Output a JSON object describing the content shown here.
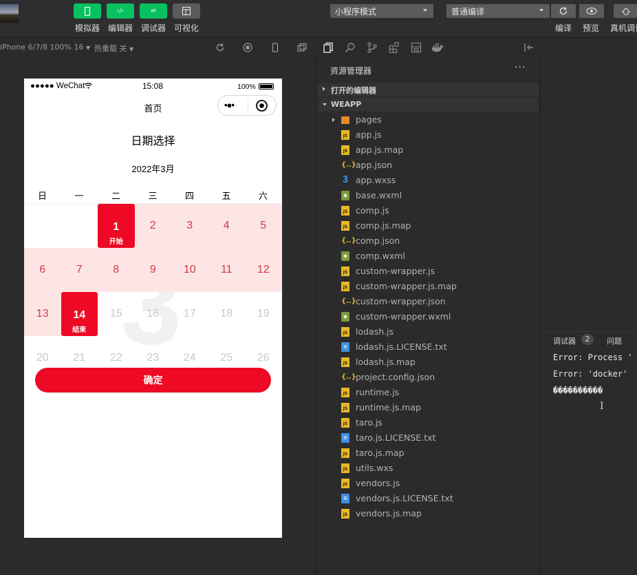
{
  "toolbar": {
    "buttons": [
      {
        "label": "模拟器"
      },
      {
        "label": "编辑器"
      },
      {
        "label": "调试器"
      },
      {
        "label": "可视化"
      }
    ],
    "mode_select": "小程序模式",
    "compile_select": "普通编译",
    "right_labels": [
      "编译",
      "预览",
      "真机调试"
    ]
  },
  "simbar": {
    "device": "iPhone 6/7/8 100% 16",
    "hot_reload": "热重载 关"
  },
  "phone": {
    "status": {
      "carrier": "●●●●● WeChat",
      "time": "15:08",
      "battery": "100%"
    },
    "nav_title": "首页",
    "page_title": "日期选择",
    "month": "2022年3月",
    "watermark": "3",
    "weekdays": [
      "日",
      "一",
      "二",
      "三",
      "四",
      "五",
      "六"
    ],
    "rows": [
      [
        {
          "d": "",
          "s": "empty"
        },
        {
          "d": "",
          "s": "empty"
        },
        {
          "d": "1",
          "s": "start",
          "sub": "开始"
        },
        {
          "d": "2",
          "s": "range"
        },
        {
          "d": "3",
          "s": "range"
        },
        {
          "d": "4",
          "s": "range"
        },
        {
          "d": "5",
          "s": "range"
        }
      ],
      [
        {
          "d": "6",
          "s": "range"
        },
        {
          "d": "7",
          "s": "range"
        },
        {
          "d": "8",
          "s": "range"
        },
        {
          "d": "9",
          "s": "range"
        },
        {
          "d": "10",
          "s": "range"
        },
        {
          "d": "11",
          "s": "range"
        },
        {
          "d": "12",
          "s": "range"
        }
      ],
      [
        {
          "d": "13",
          "s": "range"
        },
        {
          "d": "14",
          "s": "end",
          "sub": "结束"
        },
        {
          "d": "15",
          "s": "muted"
        },
        {
          "d": "16",
          "s": "muted"
        },
        {
          "d": "17",
          "s": "muted"
        },
        {
          "d": "18",
          "s": "muted"
        },
        {
          "d": "19",
          "s": "muted"
        }
      ],
      [
        {
          "d": "20",
          "s": "muted"
        },
        {
          "d": "21",
          "s": "muted"
        },
        {
          "d": "22",
          "s": "muted"
        },
        {
          "d": "23",
          "s": "muted"
        },
        {
          "d": "24",
          "s": "muted"
        },
        {
          "d": "25",
          "s": "muted"
        },
        {
          "d": "26",
          "s": "muted"
        }
      ]
    ],
    "confirm": "确定"
  },
  "explorer": {
    "title": "资源管理器",
    "more": "···",
    "open_editors": "打开的编辑器",
    "root": "WEAPP",
    "files": [
      {
        "name": "pages",
        "type": "folder"
      },
      {
        "name": "app.js",
        "type": "js"
      },
      {
        "name": "app.js.map",
        "type": "js"
      },
      {
        "name": "app.json",
        "type": "json"
      },
      {
        "name": "app.wxss",
        "type": "wxss"
      },
      {
        "name": "base.wxml",
        "type": "wxml"
      },
      {
        "name": "comp.js",
        "type": "js"
      },
      {
        "name": "comp.js.map",
        "type": "js"
      },
      {
        "name": "comp.json",
        "type": "json"
      },
      {
        "name": "comp.wxml",
        "type": "wxml"
      },
      {
        "name": "custom-wrapper.js",
        "type": "js"
      },
      {
        "name": "custom-wrapper.js.map",
        "type": "js"
      },
      {
        "name": "custom-wrapper.json",
        "type": "json"
      },
      {
        "name": "custom-wrapper.wxml",
        "type": "wxml"
      },
      {
        "name": "lodash.js",
        "type": "js"
      },
      {
        "name": "lodash.js.LICENSE.txt",
        "type": "txt"
      },
      {
        "name": "lodash.js.map",
        "type": "js"
      },
      {
        "name": "project.config.json",
        "type": "json"
      },
      {
        "name": "runtime.js",
        "type": "js"
      },
      {
        "name": "runtime.js.map",
        "type": "js"
      },
      {
        "name": "taro.js",
        "type": "js"
      },
      {
        "name": "taro.js.LICENSE.txt",
        "type": "txt"
      },
      {
        "name": "taro.js.map",
        "type": "js"
      },
      {
        "name": "utils.wxs",
        "type": "js"
      },
      {
        "name": "vendors.js",
        "type": "js"
      },
      {
        "name": "vendors.js.LICENSE.txt",
        "type": "txt"
      },
      {
        "name": "vendors.js.map",
        "type": "js"
      }
    ]
  },
  "console": {
    "tab_debugger": "调试器",
    "badge": "2",
    "tab_problems": "问题",
    "lines": [
      "Error: Process '",
      "Error: 'docker'",
      "����������"
    ]
  },
  "colors": {
    "accent": "#ee0a24",
    "range": "#fde5e6",
    "wechat_green": "#07c160"
  }
}
